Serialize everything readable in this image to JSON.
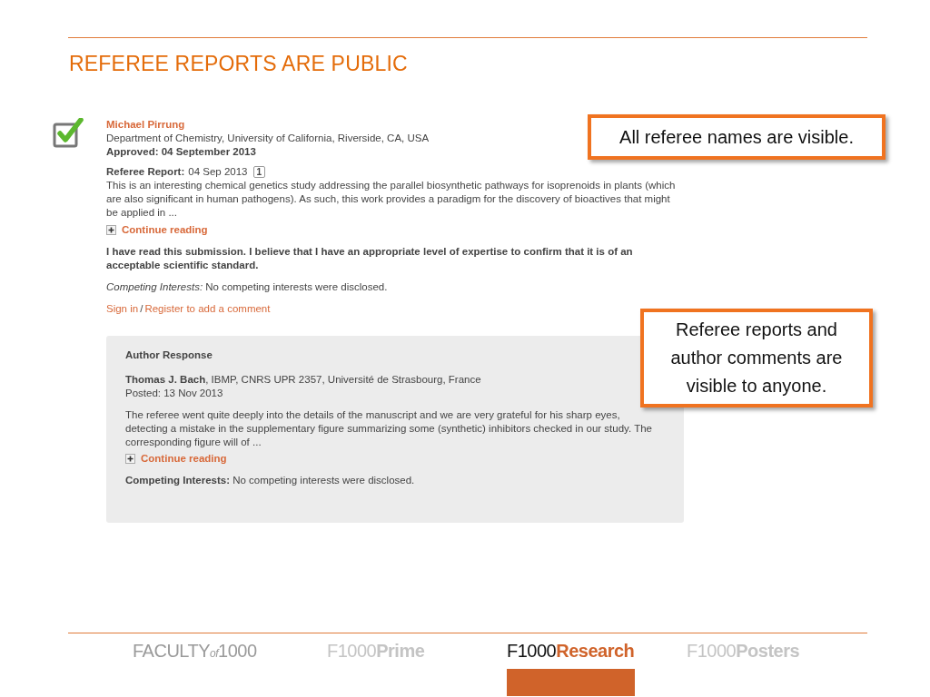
{
  "slide_title": "REFEREE REPORTS ARE PUBLIC",
  "report": {
    "approved": true,
    "referee_name": "Michael Pirrung",
    "affiliation": "Department of Chemistry, University of California, Riverside, CA, USA",
    "status": "Approved: 04 September 2013",
    "report_label": "Referee Report:",
    "report_date": "04 Sep 2013",
    "comment_count": "1",
    "excerpt": "This is an interesting chemical genetics study addressing the parallel biosynthetic pathways for isoprenoids in plants (which are also significant in human pathogens). As such, this work provides a paradigm for the discovery of bioactives that might be applied in ...",
    "continue_reading": "Continue reading",
    "statement": "I have read this submission. I believe that I have an appropriate level of expertise to confirm that it is of an acceptable scientific standard.",
    "competing_interests": "*Competing Interests:* No competing interests were disclosed.",
    "sign_in": "Sign in",
    "separator": "/",
    "register": "Register to add a comment"
  },
  "author_response": {
    "heading": "Author Response",
    "author": "**Thomas J. Bach**, IBMP, CNRS UPR 2357, Université de Strasbourg, France",
    "posted": "Posted: 13 Nov 2013",
    "excerpt": "The referee went quite deeply into the details of the manuscript and we are very grateful for his sharp eyes, detecting a mistake in the supplementary figure summarizing some (synthetic) inhibitors checked in our study. The corresponding figure will of ...",
    "continue_reading": "Continue reading",
    "competing_interests": "**Competing Interests:** No competing interests were disclosed."
  },
  "callouts": [
    "All referee names are visible.",
    "Referee reports and author comments are visible to anyone."
  ],
  "logos": [
    {
      "parts": [
        "FACULTY",
        "of",
        "1000"
      ],
      "selected": false
    },
    {
      "parts": [
        "F1000",
        "Prime"
      ],
      "selected": false
    },
    {
      "parts": [
        "F1000",
        "Research"
      ],
      "selected": true
    },
    {
      "parts": [
        "F1000",
        "Posters"
      ],
      "selected": false
    }
  ]
}
